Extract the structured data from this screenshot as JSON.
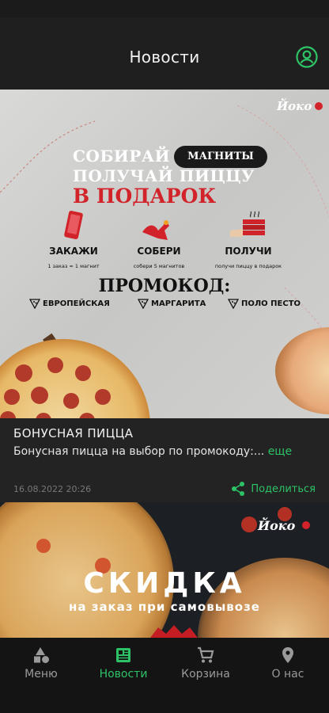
{
  "header": {
    "title": "Новости"
  },
  "news": [
    {
      "banner": {
        "logo": "Йоко",
        "headline_line1": "СОБИРАЙ",
        "pill": "МАГНИТЫ",
        "headline_line2": "ПОЛУЧАЙ ПИЦЦУ",
        "headline_line3": "В ПОДАРОК",
        "steps": [
          {
            "title": "ЗАКАЖИ",
            "subtitle": "1 заказ = 1 магнит"
          },
          {
            "title": "СОБЕРИ",
            "subtitle": "собери 5 магнитов"
          },
          {
            "title": "ПОЛУЧИ",
            "subtitle": "получи пиццу в подарок"
          }
        ],
        "promo_title": "ПРОМОКОД:",
        "promo_codes": [
          "ЕВРОПЕЙСКАЯ",
          "МАРГАРИТА",
          "ПОЛО ПЕСТО"
        ]
      },
      "title": "БОНУСНАЯ ПИЦЦА",
      "text": "Бонусная пицца на выбор по промокоду:...",
      "more": "еще",
      "date": "16.08.2022 20:26",
      "share_label": "Поделиться"
    },
    {
      "banner": {
        "logo": "Йоко",
        "headline": "СКИДКА",
        "subheadline": "на заказ при самовывозе"
      }
    }
  ],
  "nav": [
    {
      "label": "Меню",
      "icon": "shapes-icon"
    },
    {
      "label": "Новости",
      "icon": "news-icon"
    },
    {
      "label": "Корзина",
      "icon": "cart-icon"
    },
    {
      "label": "О нас",
      "icon": "location-pin-icon"
    }
  ],
  "active_tab": "Новости",
  "colors": {
    "accent": "#2ec267",
    "background": "#1e1e1e",
    "brand_red": "#d2232a"
  }
}
